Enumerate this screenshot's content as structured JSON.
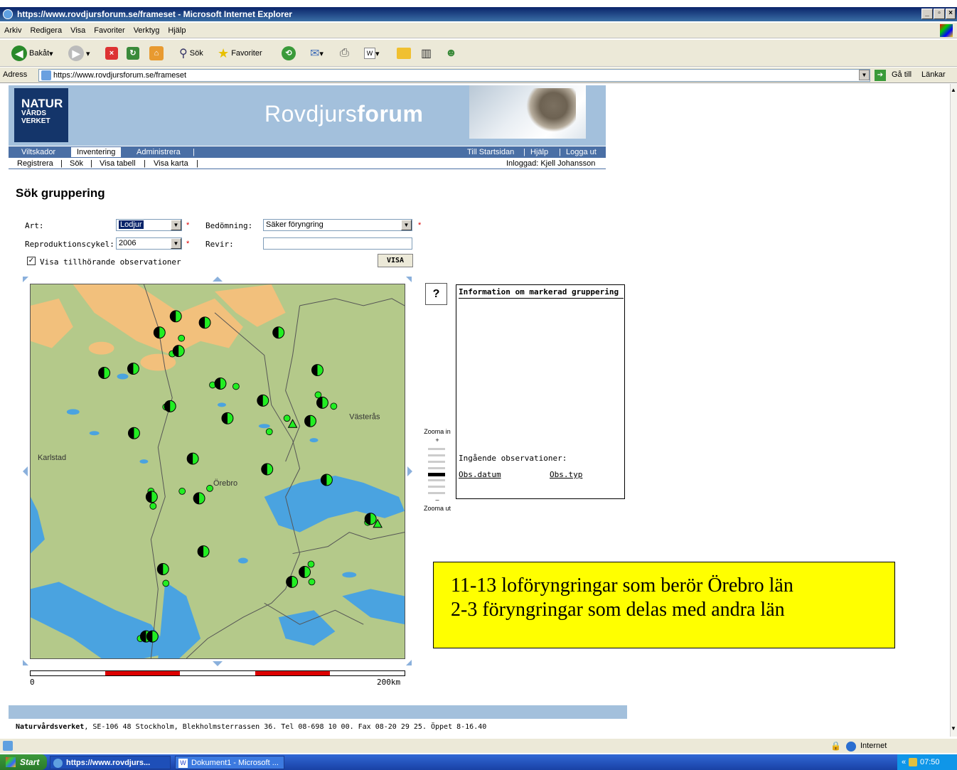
{
  "window": {
    "title": "https://www.rovdjursforum.se/frameset - Microsoft Internet Explorer"
  },
  "menu": [
    "Arkiv",
    "Redigera",
    "Visa",
    "Favoriter",
    "Verktyg",
    "Hjälp"
  ],
  "toolbar": {
    "back": "Bakåt",
    "search": "Sök",
    "favorites": "Favoriter"
  },
  "address": {
    "label": "Adress",
    "url": "https://www.rovdjursforum.se/frameset",
    "go": "Gå till",
    "links": "Länkar"
  },
  "header": {
    "logo_l1": "NATUR",
    "logo_l2": "VÅRDS",
    "logo_l3": "VERKET",
    "brand_light": "Rovdjurs",
    "brand_bold": "forum"
  },
  "nav": {
    "tabs": [
      "Viltskador",
      "Inventering",
      "Administrera"
    ],
    "right": [
      "Till Startsidan",
      "Hjälp",
      "Logga ut"
    ],
    "sub": [
      "Registrera",
      "Sök",
      "Visa tabell",
      "Visa karta"
    ],
    "logged_in": "Inloggad: Kjell Johansson"
  },
  "page": {
    "title": "Sök gruppering"
  },
  "form": {
    "art_label": "Art:",
    "art_value": "Lodjur",
    "bed_label": "Bedömning:",
    "bed_value": "Säker föryngring",
    "rep_label": "Reproduktionscykel:",
    "rep_value": "2006",
    "revir_label": "Revir:",
    "revir_value": "",
    "checkbox_label": "Visa tillhörande observationer",
    "visa": "VISA"
  },
  "map": {
    "labels": [
      "Karlstad",
      "Örebro",
      "Västerås"
    ],
    "scale_start": "0",
    "scale_end": "200km",
    "zoom_in": "Zooma in",
    "zoom_out": "Zooma ut",
    "plus": "+",
    "minus": "–"
  },
  "info": {
    "help": "?",
    "title": "Information om markerad gruppering",
    "obs_title": "Ingående observationer:",
    "col1": "Obs.datum",
    "col2": "Obs.typ"
  },
  "annotation": {
    "line1": "11-13 loföryngringar som berör Örebro län",
    "line2": "2-3 föryngringar som delas med andra län"
  },
  "footer": {
    "org": "Naturvårdsverket",
    "text": ", SE-106 48 Stockholm, Blekholmsterrassen 36. Tel 08-698 10 00. Fax 08-20 29 25. Öppet 8-16.40"
  },
  "status": {
    "zone": "Internet"
  },
  "taskbar": {
    "start": "Start",
    "task1": "https://www.rovdjurs...",
    "task2": "Dokument1 - Microsoft ...",
    "clock": "07:50"
  }
}
